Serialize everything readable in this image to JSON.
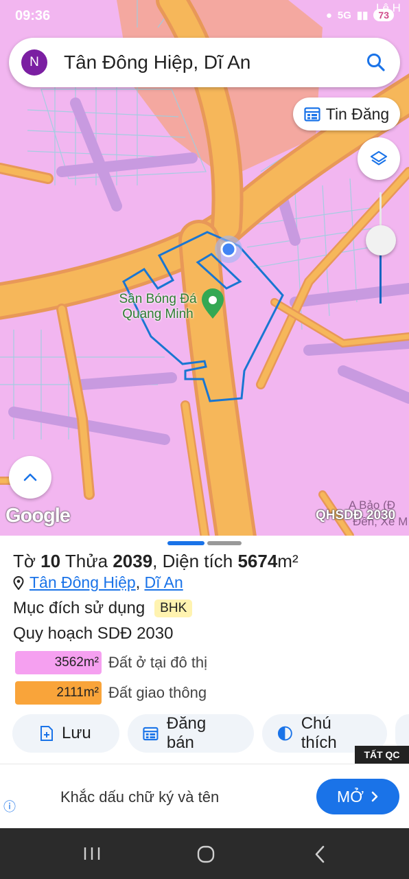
{
  "status": {
    "time": "09:36",
    "network": "5G",
    "battery": "73"
  },
  "search": {
    "avatar_letter": "N",
    "query": "Tân Đông Hiệp, Dĩ An"
  },
  "map": {
    "tin_dang_label": "Tin Đăng",
    "poi_label": "Sân Bóng Đá Quang Minh",
    "google_label": "Google",
    "layer_badge": "QHSDĐ 2030",
    "street_text_1": "Lê H",
    "street_text_2": "A Bảo (Đ",
    "street_text_3": "Đền, Xe M"
  },
  "parcel": {
    "to_label": "Tờ",
    "to_number": "10",
    "thua_label": "Thửa",
    "thua_number": "2039",
    "area_label": ", Diện tích",
    "area_value": "5674",
    "area_unit": "m²",
    "location_ward": "Tân Đông Hiệp",
    "location_sep": ",",
    "location_city": "Dĩ An",
    "purpose_label": "Mục đích sử dụng",
    "purpose_code": "BHK",
    "plan_label": "Quy hoạch SDĐ 2030",
    "land_uses": [
      {
        "area": "3562m²",
        "label": "Đất ở tại đô thị",
        "color": "#f5a0f0"
      },
      {
        "area": "2111m²",
        "label": "Đất giao thông",
        "color": "#f9a43a"
      }
    ]
  },
  "actions": {
    "save": "Lưu",
    "post_sale": "Đăng bán",
    "legend": "Chú thích"
  },
  "ad": {
    "tag": "TẤT QC",
    "text": "Khắc dấu chữ ký và tên",
    "button": "MỞ"
  }
}
